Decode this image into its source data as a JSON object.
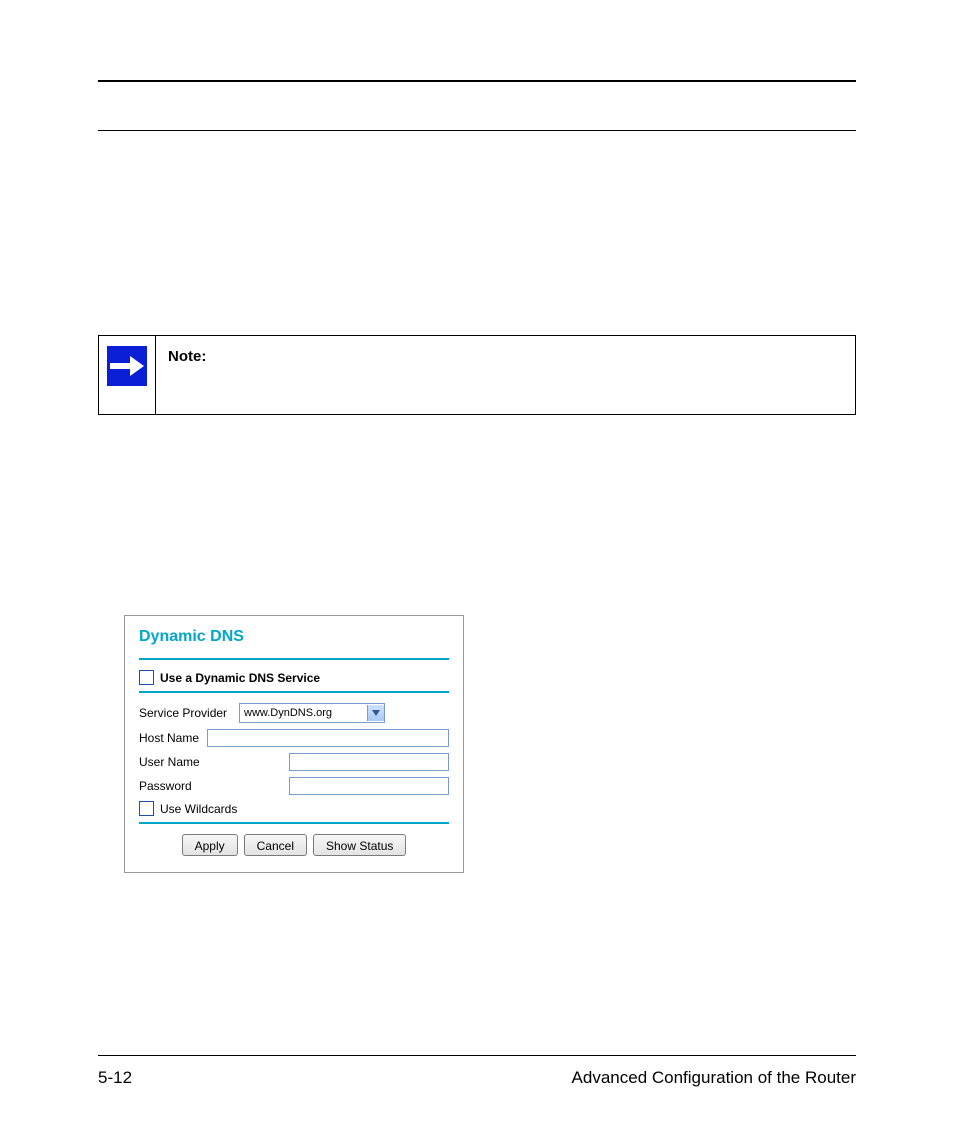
{
  "note": {
    "label": "Note:",
    "text": ""
  },
  "ddns": {
    "title": "Dynamic DNS",
    "use_service_label": "Use a Dynamic DNS Service",
    "provider_label": "Service Provider",
    "provider_value": "www.DynDNS.org",
    "host_label": "Host Name",
    "user_label": "User Name",
    "password_label": "Password",
    "wildcards_label": "Use Wildcards",
    "buttons": {
      "apply": "Apply",
      "cancel": "Cancel",
      "show_status": "Show Status"
    }
  },
  "footer": {
    "page_number": "5-12",
    "section": "Advanced Configuration of the Router"
  }
}
